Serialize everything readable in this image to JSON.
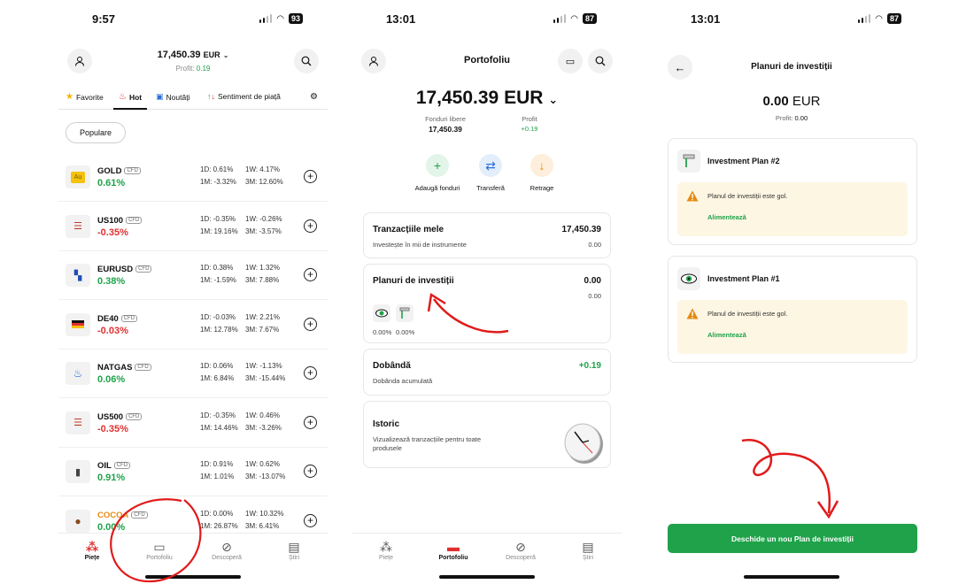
{
  "screen1": {
    "status": {
      "time": "9:57",
      "battery": "93"
    },
    "header": {
      "balance": "17,450.39",
      "currency": "EUR",
      "profit_label": "Profit:",
      "profit_value": "0.19"
    },
    "tabs": [
      {
        "label": "Favorite",
        "icon": "star-icon"
      },
      {
        "label": "Hot",
        "icon": "flame-icon"
      },
      {
        "label": "Noutăți",
        "icon": "news-icon"
      },
      {
        "label": "Sentiment de piață",
        "icon": "sentiment-icon"
      }
    ],
    "filter_chip": "Populare",
    "markets": [
      {
        "name": "GOLD",
        "tag": "CFD",
        "change": "0.61%",
        "dir": "up",
        "d1": "1D: 0.61%",
        "m1": "1M: -3.32%",
        "w1": "1W: 4.17%",
        "m3": "3M: 12.60%",
        "icon": "gold-icon"
      },
      {
        "name": "US100",
        "tag": "CFD",
        "change": "-0.35%",
        "dir": "down",
        "d1": "1D: -0.35%",
        "m1": "1M: 19.16%",
        "w1": "1W: -0.26%",
        "m3": "3M: -3.57%",
        "icon": "us-flag-icon"
      },
      {
        "name": "EURUSD",
        "tag": "CFD",
        "change": "0.38%",
        "dir": "up",
        "d1": "1D: 0.38%",
        "m1": "1M: -1.59%",
        "w1": "1W: 1.32%",
        "m3": "3M: 7.88%",
        "icon": "eu-us-flag-icon"
      },
      {
        "name": "DE40",
        "tag": "CFD",
        "change": "-0.03%",
        "dir": "down",
        "d1": "1D: -0.03%",
        "m1": "1M: 12.78%",
        "w1": "1W: 2.21%",
        "m3": "3M: 7.67%",
        "icon": "de-flag-icon"
      },
      {
        "name": "NATGAS",
        "tag": "CFD",
        "change": "0.06%",
        "dir": "up",
        "d1": "1D: 0.06%",
        "m1": "1M: 6.84%",
        "w1": "1W: -1.13%",
        "m3": "3M: -15.44%",
        "icon": "flame-icon"
      },
      {
        "name": "US500",
        "tag": "CFD",
        "change": "-0.35%",
        "dir": "down",
        "d1": "1D: -0.35%",
        "m1": "1M: 14.46%",
        "w1": "1W: 0.46%",
        "m3": "3M: -3.26%",
        "icon": "us-flag-icon"
      },
      {
        "name": "OIL",
        "tag": "CFD",
        "change": "0.91%",
        "dir": "up",
        "d1": "1D: 0.91%",
        "m1": "1M: 1.01%",
        "w1": "1W: 0.62%",
        "m3": "3M: -13.07%",
        "icon": "oil-icon"
      },
      {
        "name": "COCOA",
        "tag": "CFD",
        "change": "0.00%",
        "dir": "up",
        "d1": "1D: 0.00%",
        "m1": "1M: 26.87%",
        "w1": "1W: 10.32%",
        "m3": "3M: 6.41%",
        "icon": "cocoa-icon"
      }
    ],
    "nav": [
      {
        "label": "Piețe",
        "icon": "markets-icon"
      },
      {
        "label": "Portofoliu",
        "icon": "wallet-icon"
      },
      {
        "label": "Descoperă",
        "icon": "compass-icon"
      },
      {
        "label": "Știri",
        "icon": "news-icon"
      }
    ]
  },
  "screen2": {
    "status": {
      "time": "13:01",
      "battery": "87"
    },
    "title": "Portofoliu",
    "balance": "17,450.39",
    "currency": "EUR",
    "free_funds_label": "Fonduri libere",
    "free_funds_value": "17,450.39",
    "profit_label": "Profit",
    "profit_value": "+0.19",
    "actions": [
      {
        "label": "Adaugă fonduri",
        "symbol": "+",
        "color": "#1fa24a",
        "bg": "#e3f5e8"
      },
      {
        "label": "Transferă",
        "symbol": "⇄",
        "color": "#2a6fd6",
        "bg": "#e4eefb"
      },
      {
        "label": "Retrage",
        "symbol": "↓",
        "color": "#e58a12",
        "bg": "#fdefdc"
      }
    ],
    "cards": {
      "tranzactii": {
        "title": "Tranzacțiile mele",
        "subtitle": "Investește în mii de instrumente",
        "value": "17,450.39",
        "sub_value": "0.00"
      },
      "planuri": {
        "title": "Planuri de investiții",
        "value": "0.00",
        "sub_value": "0.00",
        "pct1": "0.00%",
        "pct2": "0.00%"
      },
      "dobanda": {
        "title": "Dobândă",
        "subtitle": "Dobânda acumulată",
        "value": "+0.19"
      },
      "istoric": {
        "title": "Istoric",
        "subtitle": "Vizualizează tranzacțiile pentru toate produsele"
      }
    },
    "nav": [
      {
        "label": "Piețe"
      },
      {
        "label": "Portofoliu"
      },
      {
        "label": "Descoperă"
      },
      {
        "label": "Știri"
      }
    ]
  },
  "screen3": {
    "status": {
      "time": "13:01",
      "battery": "87"
    },
    "title": "Planuri de investiții",
    "balance": "0.00",
    "currency": "EUR",
    "profit_label": "Profit:",
    "profit_value": "0.00",
    "plans": [
      {
        "name": "Investment Plan #2",
        "warning": "Planul de investiții este gol.",
        "action": "Alimentează"
      },
      {
        "name": "Investment Plan #1",
        "warning": "Planul de investiții este gol.",
        "action": "Alimentează"
      }
    ],
    "cta": "Deschide un nou Plan de investiții"
  },
  "colors": {
    "brand_green": "#1fa24a",
    "negative_red": "#e03131",
    "annotation_red": "#e01b1b",
    "warning_bg": "#fdf6e3"
  }
}
